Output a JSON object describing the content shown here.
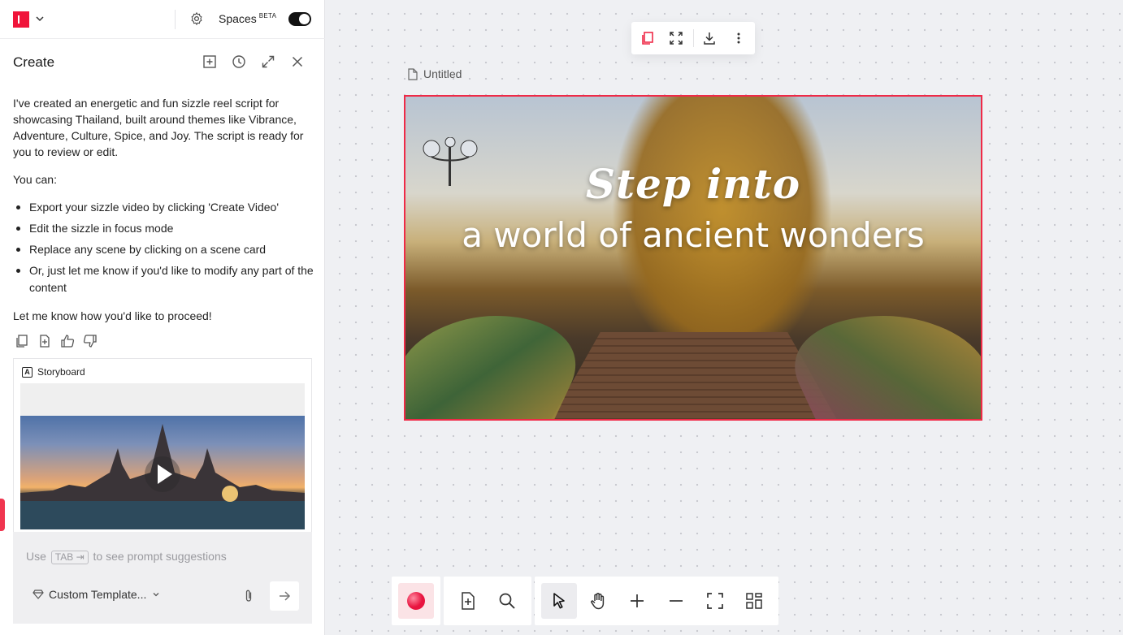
{
  "topbar": {
    "spaces_label": "Spaces",
    "spaces_badge": "BETA",
    "spaces_enabled": true,
    "brand_color": "#f0143a"
  },
  "create_panel": {
    "title": "Create",
    "header_icons": [
      "add-square-icon",
      "history-icon",
      "expand-icon",
      "close-icon"
    ],
    "message": {
      "intro": "I've created an energetic and fun sizzle reel script for showcasing Thailand, built around themes like Vibrance, Adventure, Culture, Spice, and Joy. The script is ready for you to review or edit.",
      "you_can": "You can:",
      "options": [
        "Export your sizzle video by clicking 'Create Video'",
        "Edit the sizzle in focus mode",
        "Replace any scene by clicking on a scene card",
        "Or, just let me know if you'd like to modify any part of the content"
      ],
      "closing": "Let me know how you'd like to proceed!"
    },
    "feedback_icons": [
      "copy-icon",
      "add-document-icon",
      "thumbs-up-icon",
      "thumbs-down-icon"
    ],
    "storyboard": {
      "label": "Storyboard"
    },
    "composer": {
      "hint_prefix": "Use",
      "hint_key": "TAB ⇥",
      "hint_suffix": "to see prompt suggestions",
      "template_label": "Custom Template..."
    }
  },
  "canvas": {
    "doc_title": "Untitled",
    "scene": {
      "title_line1": "Step into",
      "title_line2": "a world of ancient wonders"
    },
    "accent_color": "#ef2a47"
  }
}
